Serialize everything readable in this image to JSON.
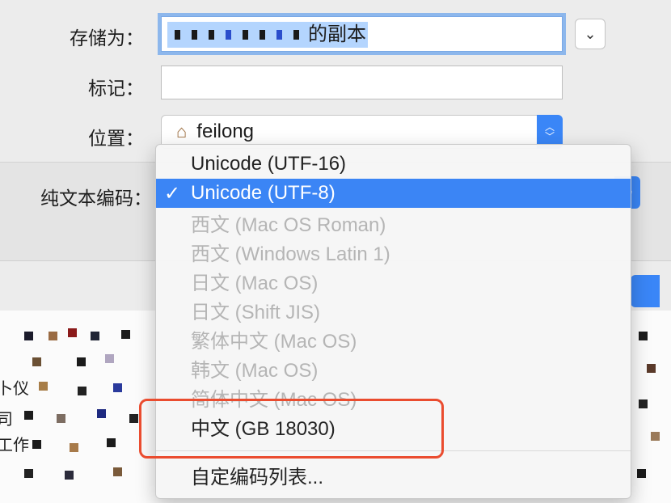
{
  "save_as": {
    "label": "存储为：",
    "filename_suffix": "的副本"
  },
  "tags": {
    "label": "标记：",
    "value": ""
  },
  "location": {
    "label": "位置：",
    "value": "feilong",
    "icon": "home-icon"
  },
  "encoding": {
    "label": "纯文本编码："
  },
  "menu": {
    "items": [
      {
        "label": "Unicode (UTF-16)",
        "state": "normal"
      },
      {
        "label": "Unicode (UTF-8)",
        "state": "selected",
        "check": "✓"
      },
      {
        "label": "西文 (Mac OS Roman)",
        "state": "disabled"
      },
      {
        "label": "西文 (Windows Latin 1)",
        "state": "disabled"
      },
      {
        "label": "日文 (Mac OS)",
        "state": "disabled"
      },
      {
        "label": "日文 (Shift JIS)",
        "state": "disabled"
      },
      {
        "label": "繁体中文 (Mac OS)",
        "state": "disabled"
      },
      {
        "label": "韩文 (Mac OS)",
        "state": "disabled"
      },
      {
        "label": "简体中文 (Mac OS)",
        "state": "disabled"
      },
      {
        "label": "中文 (GB 18030)",
        "state": "normal"
      }
    ],
    "customize": "自定编码列表..."
  },
  "doc_fragments": [
    "卜仪",
    "司",
    "工作"
  ],
  "colors": {
    "accent": "#3b85f5",
    "highlight": "#ea4c2f",
    "selection": "#b4d5fe"
  }
}
